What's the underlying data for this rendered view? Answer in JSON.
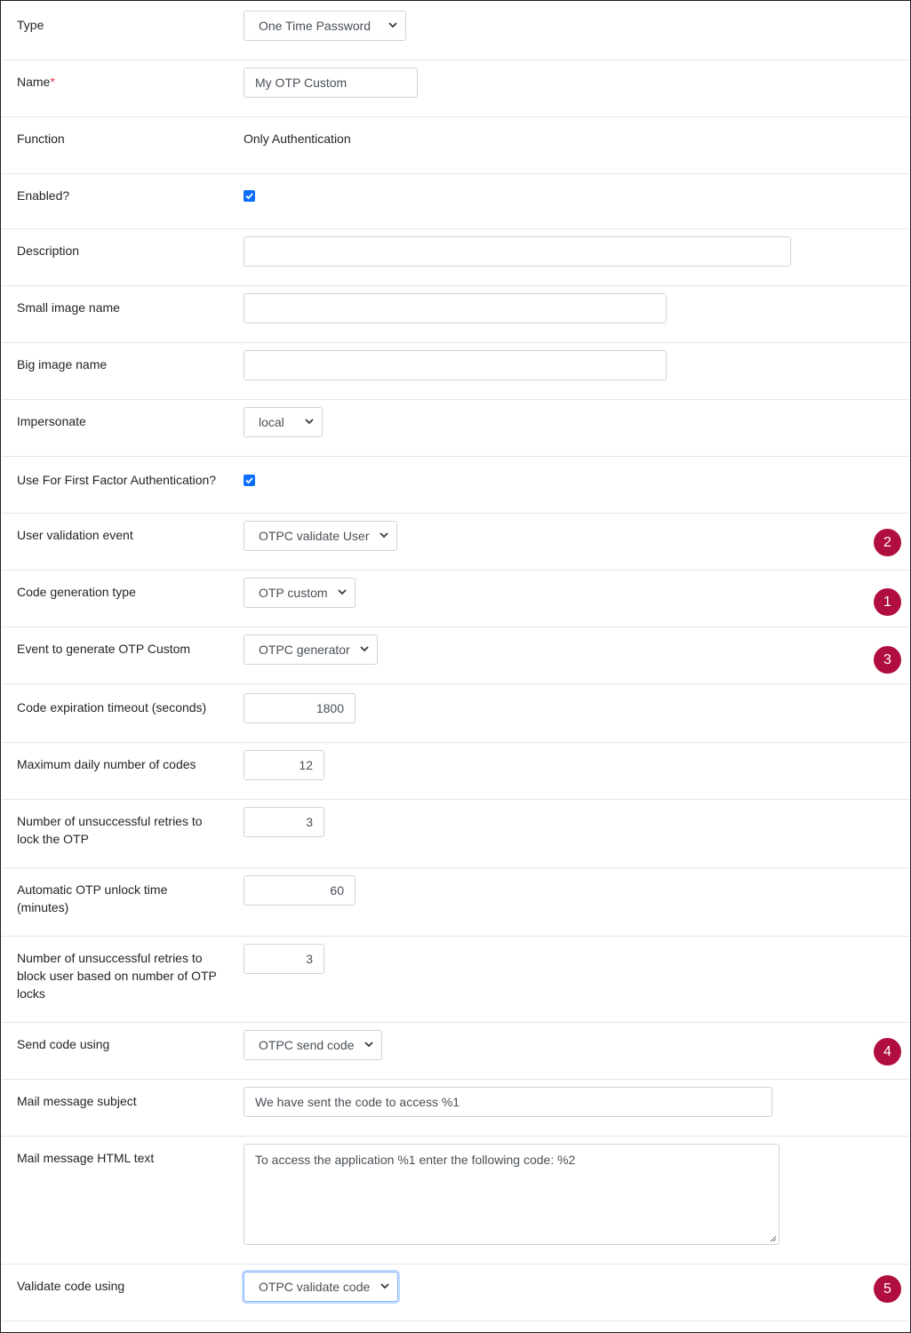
{
  "form": {
    "type": {
      "label": "Type",
      "value": "One Time Password"
    },
    "name": {
      "label": "Name",
      "required_mark": "*",
      "value": "My OTP Custom"
    },
    "function": {
      "label": "Function",
      "value": "Only Authentication"
    },
    "enabled": {
      "label": "Enabled?",
      "checked": true
    },
    "description": {
      "label": "Description",
      "value": ""
    },
    "small_image": {
      "label": "Small image name",
      "value": ""
    },
    "big_image": {
      "label": "Big image name",
      "value": ""
    },
    "impersonate": {
      "label": "Impersonate",
      "value": "local"
    },
    "first_factor": {
      "label": "Use For First Factor Authentication?",
      "checked": true
    },
    "user_validation_event": {
      "label": "User validation event",
      "value": "OTPC validate User",
      "badge": "2"
    },
    "code_generation_type": {
      "label": "Code generation type",
      "value": "OTP custom",
      "badge": "1"
    },
    "event_generate": {
      "label": "Event to generate OTP Custom",
      "value": "OTPC generator",
      "badge": "3"
    },
    "code_expiration": {
      "label": "Code expiration timeout (seconds)",
      "value": "1800"
    },
    "max_daily_codes": {
      "label": "Maximum daily number of codes",
      "value": "12"
    },
    "retries_lock_line1": "Number of unsuccessful retries to",
    "retries_lock_line2": "lock the OTP",
    "retries_lock_value": "3",
    "unlock_time_line1": "Automatic OTP unlock time",
    "unlock_time_line2": "(minutes)",
    "unlock_time_value": "60",
    "retries_block_line1": "Number of unsuccessful retries to",
    "retries_block_line2": "block user based on number of OTP",
    "retries_block_line3": "locks",
    "retries_block_value": "3",
    "send_code": {
      "label": "Send code using",
      "value": "OTPC send code",
      "badge": "4"
    },
    "mail_subject": {
      "label": "Mail message subject",
      "value": "We have sent the code to access %1"
    },
    "mail_html": {
      "label": "Mail message HTML text",
      "value": "To access the application %1 enter the following code: %2"
    },
    "validate_code": {
      "label": "Validate code using",
      "value": "OTPC validate code",
      "badge": "5"
    }
  },
  "colors": {
    "badge": "#b00e3e",
    "checkbox": "#0d6efd",
    "required": "#dc3545"
  }
}
